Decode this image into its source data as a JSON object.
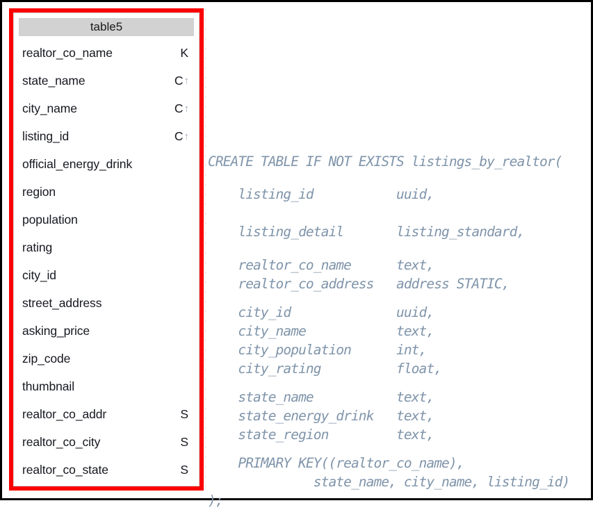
{
  "diagram": {
    "highlight_color": "#fb0000",
    "header_bg": "#d2d2d2",
    "code_color": "#7f94aa"
  },
  "table": {
    "title": "table5",
    "columns": [
      {
        "name": "realtor_co_name",
        "marker": "K",
        "arrow": ""
      },
      {
        "name": "state_name",
        "marker": "C",
        "arrow": "↑"
      },
      {
        "name": "city_name",
        "marker": "C",
        "arrow": "↑"
      },
      {
        "name": "listing_id",
        "marker": "C",
        "arrow": "↑"
      },
      {
        "name": "official_energy_drink",
        "marker": "",
        "arrow": ""
      },
      {
        "name": "region",
        "marker": "",
        "arrow": ""
      },
      {
        "name": "population",
        "marker": "",
        "arrow": ""
      },
      {
        "name": "rating",
        "marker": "",
        "arrow": ""
      },
      {
        "name": "city_id",
        "marker": "",
        "arrow": ""
      },
      {
        "name": "street_address",
        "marker": "",
        "arrow": ""
      },
      {
        "name": "asking_price",
        "marker": "",
        "arrow": ""
      },
      {
        "name": "zip_code",
        "marker": "",
        "arrow": ""
      },
      {
        "name": "thumbnail",
        "marker": "",
        "arrow": ""
      },
      {
        "name": "realtor_co_addr",
        "marker": "S",
        "arrow": ""
      },
      {
        "name": "realtor_co_city",
        "marker": "S",
        "arrow": ""
      },
      {
        "name": "realtor_co_state",
        "marker": "S",
        "arrow": ""
      }
    ]
  },
  "cql": {
    "lines": [
      "CREATE TABLE IF NOT EXISTS listings_by_realtor(",
      "",
      "    listing_id           uuid,",
      "",
      "    listing_detail       listing_standard,",
      "",
      "    realtor_co_name      text,",
      "    realtor_co_address   address STATIC,",
      "",
      "    city_id              uuid,",
      "    city_name            text,",
      "    city_population      int,",
      "    city_rating          float,",
      "",
      "    state_name           text,",
      "    state_energy_drink   text,",
      "    state_region         text,",
      "",
      "    PRIMARY KEY((realtor_co_name),",
      "              state_name, city_name, listing_id)",
      ");"
    ]
  }
}
